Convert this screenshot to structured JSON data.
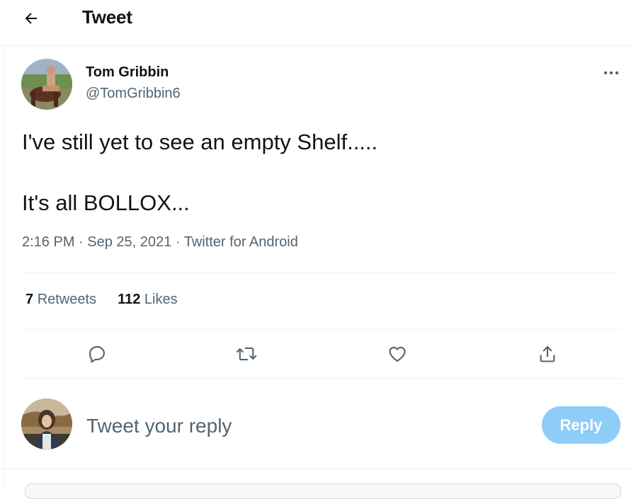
{
  "header": {
    "title": "Tweet"
  },
  "tweet": {
    "author_name": "Tom Gribbin",
    "author_handle": "@TomGribbin6",
    "text_lines": [
      "I've still yet to see an empty Shelf.....",
      "It's all BOLLOX..."
    ],
    "time": "2:16 PM",
    "date": "Sep 25, 2021",
    "source": "Twitter for Android",
    "separator": " · ",
    "retweets_count": "7",
    "retweets_label": "Retweets",
    "likes_count": "112",
    "likes_label": "Likes"
  },
  "reply": {
    "placeholder": "Tweet your reply",
    "button_label": "Reply"
  },
  "colors": {
    "text": "#0f1419",
    "secondary": "#536471",
    "divider": "#eff3f4",
    "reply_button_disabled": "#8ecdf8"
  },
  "icons": [
    "back-arrow-icon",
    "more-icon",
    "reply-icon",
    "retweet-icon",
    "like-icon",
    "share-icon"
  ]
}
